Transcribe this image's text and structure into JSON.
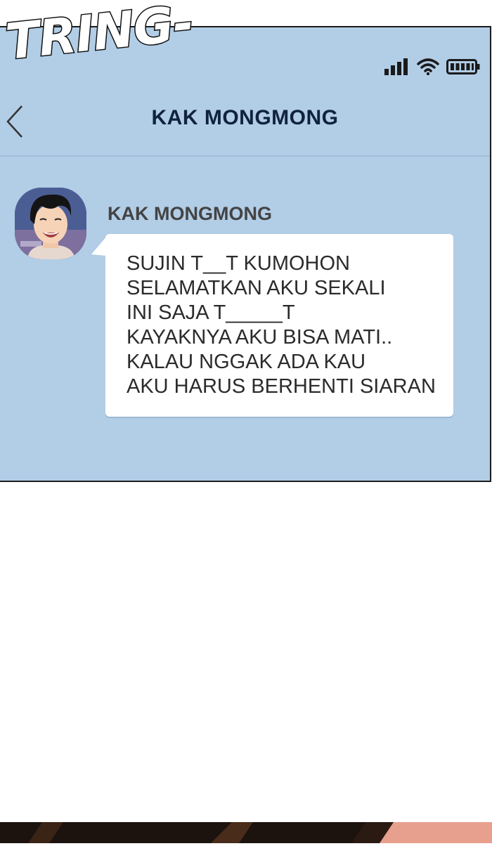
{
  "sound_effect": "TRING-",
  "status_bar": {
    "icons": [
      "cellular-signal-icon",
      "wifi-icon",
      "battery-icon"
    ]
  },
  "header": {
    "back_icon": "chevron-left-icon",
    "title": "KAK MONGMONG"
  },
  "conversation": {
    "messages": [
      {
        "sender": "KAK MONGMONG",
        "avatar": "profile-avatar",
        "lines": [
          "SUJIN T__T KUMOHON",
          "SELAMATKAN AKU SEKALI",
          "INI SAJA T_____T",
          "KAYAKNYA AKU BISA MATI..",
          "KALAU NGGAK ADA KAU",
          "AKU HARUS BERHENTI SIARAN"
        ]
      }
    ]
  },
  "colors": {
    "chat_background": "#b2cde6",
    "title_color": "#10233d",
    "bubble": "#ffffff",
    "text": "#2b2b2b"
  }
}
